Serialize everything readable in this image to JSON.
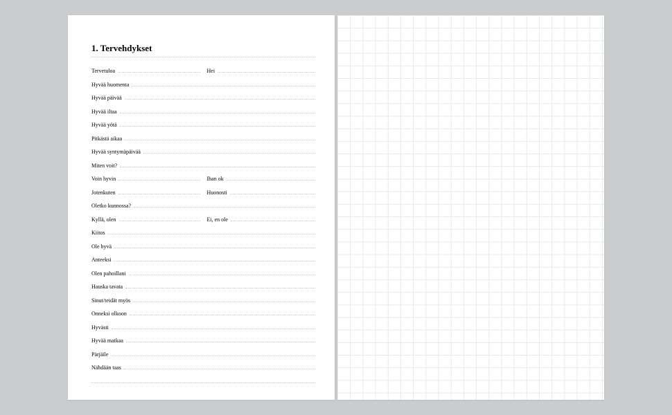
{
  "title": "1. Tervehdykset",
  "rows": [
    {
      "cells": [
        "Tervetuloa",
        "Hei"
      ]
    },
    {
      "cells": [
        "Hyvää huomenta"
      ]
    },
    {
      "cells": [
        "Hyvää päivää"
      ]
    },
    {
      "cells": [
        "Hyvää iltaa"
      ]
    },
    {
      "cells": [
        "Hyvää yötä"
      ]
    },
    {
      "cells": [
        "Pitkästä aikaa"
      ]
    },
    {
      "cells": [
        "Hyvää syntymäpäivää"
      ]
    },
    {
      "cells": [
        "Miten voit?"
      ]
    },
    {
      "cells": [
        "Voin hyvin",
        "Ihan ok"
      ]
    },
    {
      "cells": [
        "Jotenkuten",
        "Huonosti"
      ]
    },
    {
      "cells": [
        "Oletko kunnossa?"
      ]
    },
    {
      "cells": [
        "Kyllä, olen",
        "Ei, en ole"
      ]
    },
    {
      "cells": [
        "Kiitos"
      ]
    },
    {
      "cells": [
        "Ole hyvä"
      ]
    },
    {
      "cells": [
        "Anteeksi"
      ]
    },
    {
      "cells": [
        "Olen pahoillani"
      ]
    },
    {
      "cells": [
        "Hauska tavata"
      ]
    },
    {
      "cells": [
        "Sinut/teidät myös"
      ]
    },
    {
      "cells": [
        "Onneksi olkoon"
      ]
    },
    {
      "cells": [
        "Hyvästi"
      ]
    },
    {
      "cells": [
        "Hyvää matkaa"
      ]
    },
    {
      "cells": [
        "Pärjäile"
      ]
    },
    {
      "cells": [
        "Nähdään taas"
      ]
    },
    {
      "cells": [
        ""
      ]
    }
  ]
}
